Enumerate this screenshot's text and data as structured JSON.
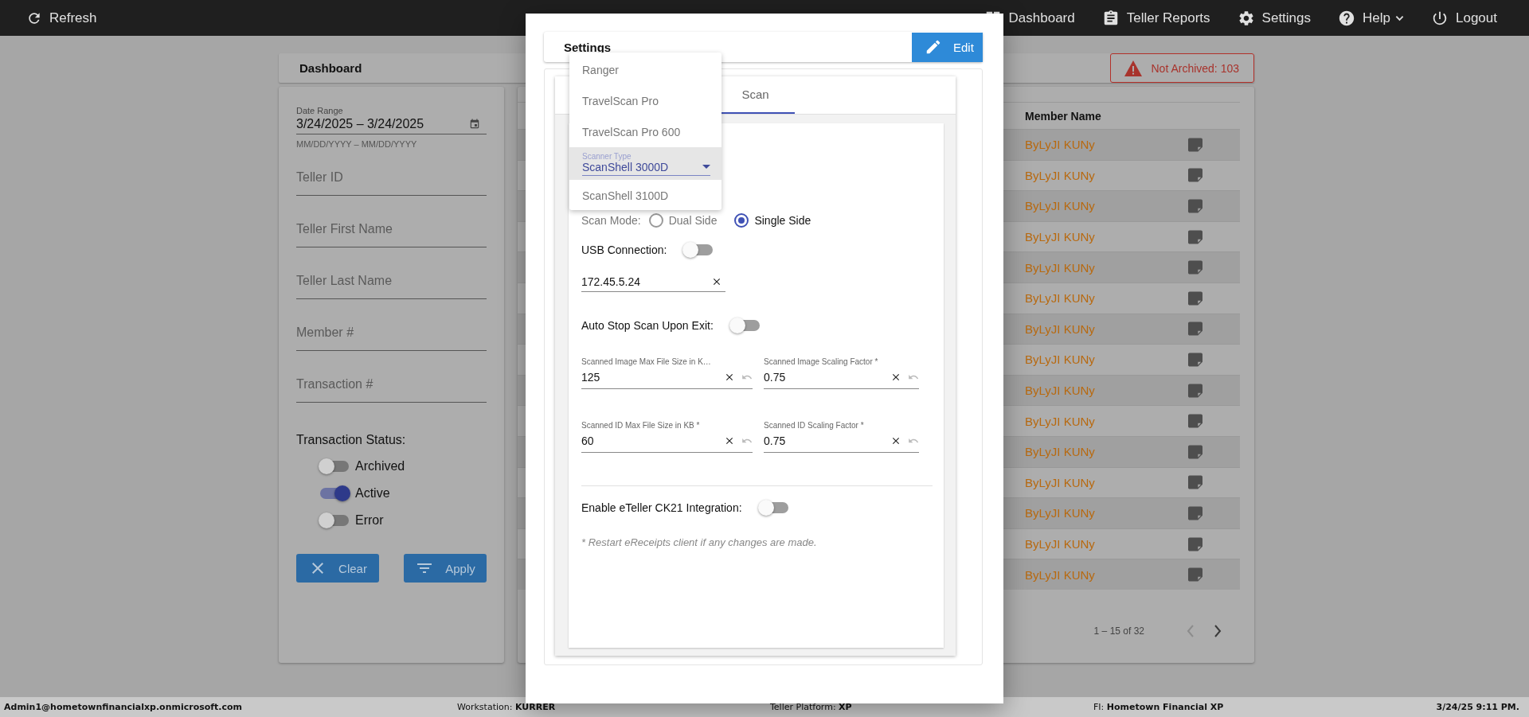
{
  "top_bar": {
    "refresh": "Refresh",
    "nav": [
      {
        "label": "Dashboard",
        "has_menu": false
      },
      {
        "label": "Teller Reports",
        "has_menu": false
      },
      {
        "label": "Settings",
        "has_menu": false
      },
      {
        "label": "Help",
        "has_menu": true
      },
      {
        "label": "Logout",
        "has_menu": false
      }
    ]
  },
  "dashboard": {
    "title": "Dashboard",
    "not_archived": "Not Archived: 103"
  },
  "filters": {
    "date_range": {
      "label": "Date Range",
      "value": "3/24/2025 – 3/24/2025",
      "hint": "MM/DD/YYYY – MM/DD/YYYY"
    },
    "fields": [
      {
        "placeholder": "Teller ID"
      },
      {
        "placeholder": "Teller First Name"
      },
      {
        "placeholder": "Teller Last Name"
      },
      {
        "placeholder": "Member #"
      },
      {
        "placeholder": "Transaction #"
      }
    ],
    "status_label": "Transaction Status:",
    "statuses": [
      {
        "label": "Archived",
        "on": false
      },
      {
        "label": "Active",
        "on": true
      },
      {
        "label": "Error",
        "on": false
      }
    ],
    "clear_button": "Clear",
    "apply_button": "Apply"
  },
  "table": {
    "columns": [
      "Member Name"
    ],
    "rows": [
      {
        "member_name": "ByLyJI KUNy"
      },
      {
        "member_name": "ByLyJI KUNy"
      },
      {
        "member_name": "ByLyJI KUNy"
      },
      {
        "member_name": "ByLyJI KUNy"
      },
      {
        "member_name": "ByLyJI KUNy"
      },
      {
        "member_name": "ByLyJI KUNy"
      },
      {
        "member_name": "ByLyJI KUNy"
      },
      {
        "member_name": "ByLyJI KUNy"
      },
      {
        "member_name": "ByLyJI KUNy"
      },
      {
        "member_name": "ByLyJI KUNy"
      },
      {
        "member_name": "ByLyJI KUNy"
      },
      {
        "member_name": "ByLyJI KUNy"
      },
      {
        "member_name": "ByLyJI KUNy"
      },
      {
        "member_name": "ByLyJI KUNy"
      },
      {
        "member_name": "ByLyJI KUNy"
      }
    ],
    "pagination": "1 – 15 of 32"
  },
  "settings_dialog": {
    "title": "Settings",
    "edit_button": "Edit",
    "tabs": [
      {
        "label": "Scan",
        "selected": true
      }
    ],
    "scanner_type": {
      "label": "Scanner Type"
    },
    "scanner_menu": [
      {
        "label": "Ranger",
        "selected": false
      },
      {
        "label": "TravelScan Pro",
        "selected": false
      },
      {
        "label": "TravelScan Pro 600",
        "selected": false
      },
      {
        "label": "ScanShell 3000D",
        "selected": true
      },
      {
        "label": "ScanShell 3100D",
        "selected": false
      }
    ],
    "scan_mode": {
      "label": "Scan Mode:",
      "options": [
        {
          "label": "Dual Side",
          "selected": false
        },
        {
          "label": "Single Side",
          "selected": true
        }
      ]
    },
    "usb_connection": {
      "label": "USB Connection:",
      "on": false
    },
    "ip_address": {
      "value": "172.45.5.24"
    },
    "auto_stop": {
      "label": "Auto Stop Scan Upon Exit:",
      "on": false
    },
    "size_fields": [
      {
        "label": "Scanned Image Max File Size in K…",
        "value": "125"
      },
      {
        "label": "Scanned Image Scaling Factor *",
        "value": "0.75"
      },
      {
        "label": "Scanned ID Max File Size in KB *",
        "value": "60"
      },
      {
        "label": "Scanned ID Scaling Factor *",
        "value": "0.75"
      }
    ],
    "eteller": {
      "label": "Enable eTeller CK21 Integration:",
      "on": false
    },
    "note": "* Restart eReceipts client if any changes are made."
  },
  "status_bar": {
    "user": "Admin1@hometownfinancialxp.onmicrosoft.com",
    "workstation": "Workstation: **KURRER**",
    "platform": "Teller Platform: **XP**",
    "fi": "FI: **Hometown Financial XP**",
    "datetime": "3/24/25 9:11 PM."
  }
}
